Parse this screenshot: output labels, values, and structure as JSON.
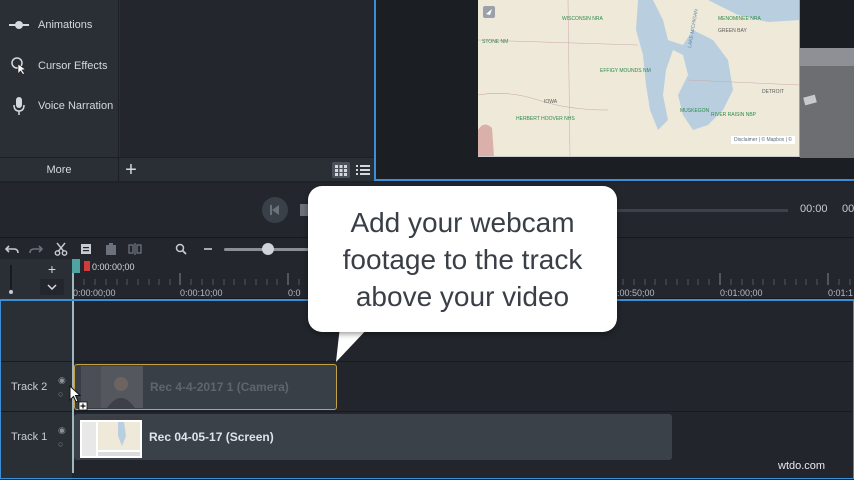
{
  "tools": {
    "items": [
      {
        "label": "Animations",
        "icon": "animations-icon"
      },
      {
        "label": "Cursor Effects",
        "icon": "cursor-effects-icon"
      },
      {
        "label": "Voice Narration",
        "icon": "microphone-icon"
      }
    ],
    "more_label": "More",
    "add_label": "+"
  },
  "canvas": {
    "map_places": [
      "WISCONSIN NRA",
      "MENOMINEE NRA",
      "STONE NM",
      "GREEN BAY",
      "EFFIGY MOUNDS NM",
      "DETROIT",
      "IOWA",
      "HERBERT HOOVER NHS",
      "MUSKEGON",
      "LAKE MICHIGAN",
      "RIVER RAISIN NBP"
    ],
    "attribution": "Disclaimer | © Mapbox | ©"
  },
  "playback": {
    "current_time": "00:00",
    "total_time": "00:0"
  },
  "timeline": {
    "playhead_time": "0:00:00;00",
    "ruler_ticks": [
      "0:00:00;00",
      "0:00:10;00",
      "0:0",
      "0:00:50;00",
      "0:01:00;00",
      "0:01:1"
    ],
    "tracks": [
      {
        "label": "Track 2",
        "clip": "Rec 4-4-2017 1 (Camera)"
      },
      {
        "label": "Track 1",
        "clip": "Rec 04-05-17 (Screen)"
      }
    ]
  },
  "callout": {
    "text": "Add your webcam footage to the track above your video"
  },
  "watermark": "wtdo.com",
  "colors": {
    "accent": "#3a8fd6",
    "selected_clip_border": "#e1b74a",
    "playhead": "#4fa3a0",
    "panel": "#2a2f36"
  }
}
